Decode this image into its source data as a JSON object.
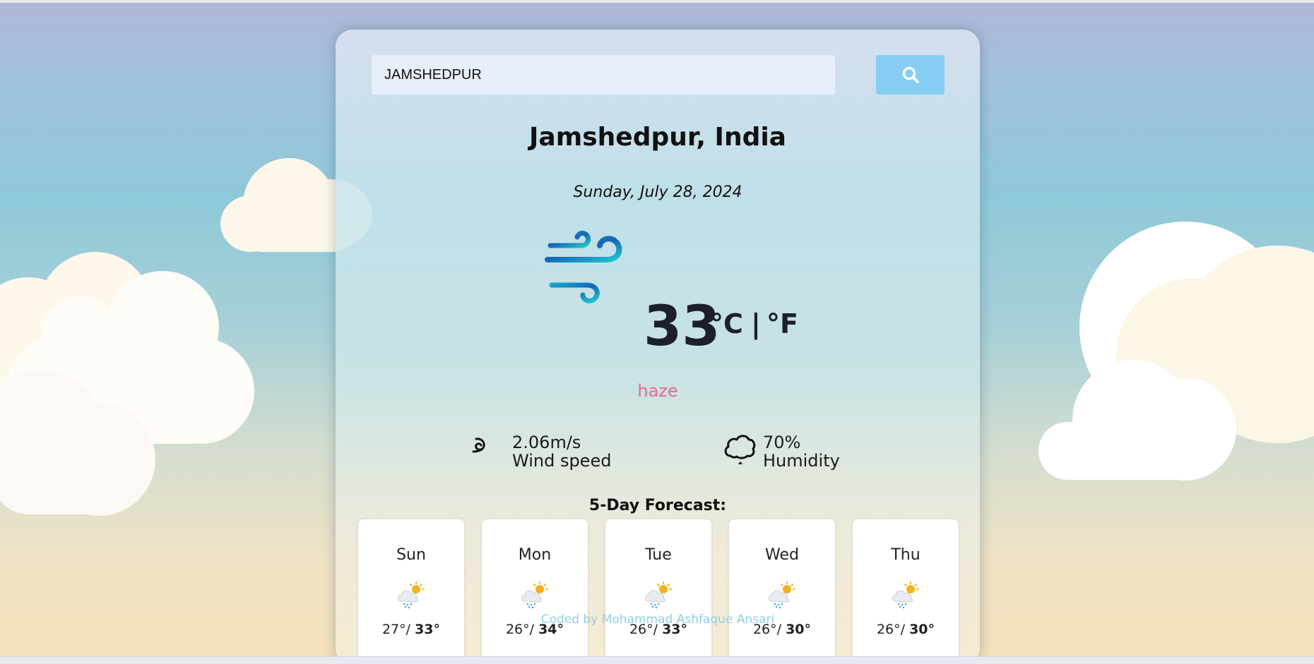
{
  "search": {
    "value": "JAMSHEDPUR"
  },
  "location": {
    "city_line": "Jamshedpur, India",
    "date": "Sunday, July 28, 2024"
  },
  "current": {
    "temperature": "33",
    "unit_c": "°C",
    "separator": "|",
    "unit_f": "°F",
    "condition": "haze",
    "icon": "wind-icon"
  },
  "stats": {
    "wind_value": "2.06m/s",
    "wind_label": "Wind speed",
    "humidity_value": "70%",
    "humidity_label": "Humidity"
  },
  "forecast": {
    "title": "5-Day Forecast:",
    "days": [
      {
        "day": "Sun",
        "min": "27°/",
        "max": "33°",
        "icon": "rain-sun-icon"
      },
      {
        "day": "Mon",
        "min": "26°/",
        "max": "34°",
        "icon": "rain-sun-icon"
      },
      {
        "day": "Tue",
        "min": "26°/",
        "max": "33°",
        "icon": "rain-sun-icon"
      },
      {
        "day": "Wed",
        "min": "26°/",
        "max": "30°",
        "icon": "rain-sun-icon"
      },
      {
        "day": "Thu",
        "min": "26°/",
        "max": "30°",
        "icon": "rain-sun-icon"
      }
    ]
  },
  "footer": {
    "credit": "Coded by Mohammad Ashfaque Ansari"
  },
  "colors": {
    "search_button": "#87cdf2",
    "condition_text": "#e8678a",
    "credit_text": "#8ccfe6"
  }
}
